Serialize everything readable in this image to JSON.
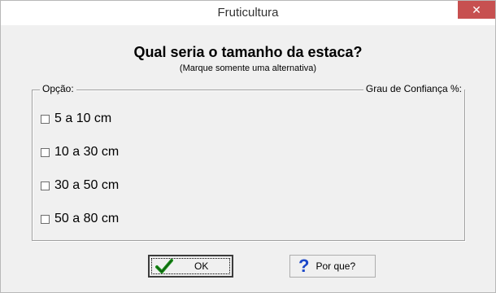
{
  "window": {
    "title": "Fruticultura",
    "close_label": "✕"
  },
  "question": {
    "text": "Qual seria o tamanho da estaca?",
    "hint": "(Marque somente uma alternativa)"
  },
  "group": {
    "left_label": "Opção:",
    "right_label": "Grau de Confiança %:"
  },
  "options": [
    {
      "label": "5 a 10 cm",
      "checked": false
    },
    {
      "label": "10 a 30 cm",
      "checked": false
    },
    {
      "label": "30 a 50 cm",
      "checked": false
    },
    {
      "label": "50 a 80 cm",
      "checked": false
    }
  ],
  "buttons": {
    "ok_label": "OK",
    "why_label": "Por que?"
  },
  "colors": {
    "close_bg": "#c75050",
    "check_green": "#1a8f1a",
    "help_blue": "#1a46c8"
  },
  "icons": {
    "ok": "check-icon",
    "why": "question-mark-icon",
    "close": "close-icon"
  }
}
